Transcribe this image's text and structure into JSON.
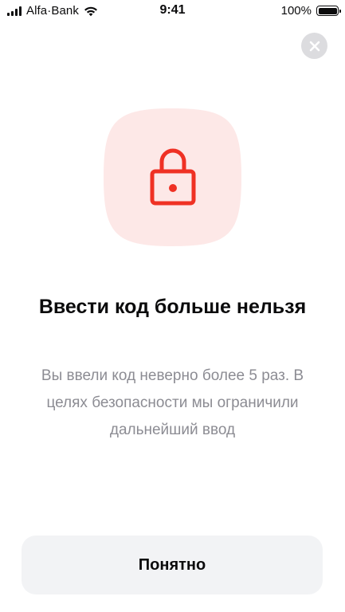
{
  "status_bar": {
    "carrier": "Alfa·Bank",
    "time": "9:41",
    "battery_percent": "100%",
    "battery_level": 1.0
  },
  "colors": {
    "accent": "#ef3124",
    "tile_background": "#fde8e7",
    "secondary_text": "#8c8c93",
    "button_background": "#f2f3f5",
    "close_background": "#dcdcdf"
  },
  "icons": {
    "close": "close-icon",
    "lock": "lock-icon",
    "signal": "signal-icon",
    "wifi": "wifi-icon",
    "battery": "battery-icon"
  },
  "dialog": {
    "title": "Ввести код больше нельзя",
    "description": "Вы ввели код неверно более 5 раз. В целях безопасности мы ограничили дальнейший ввод",
    "button_label": "Понятно"
  }
}
